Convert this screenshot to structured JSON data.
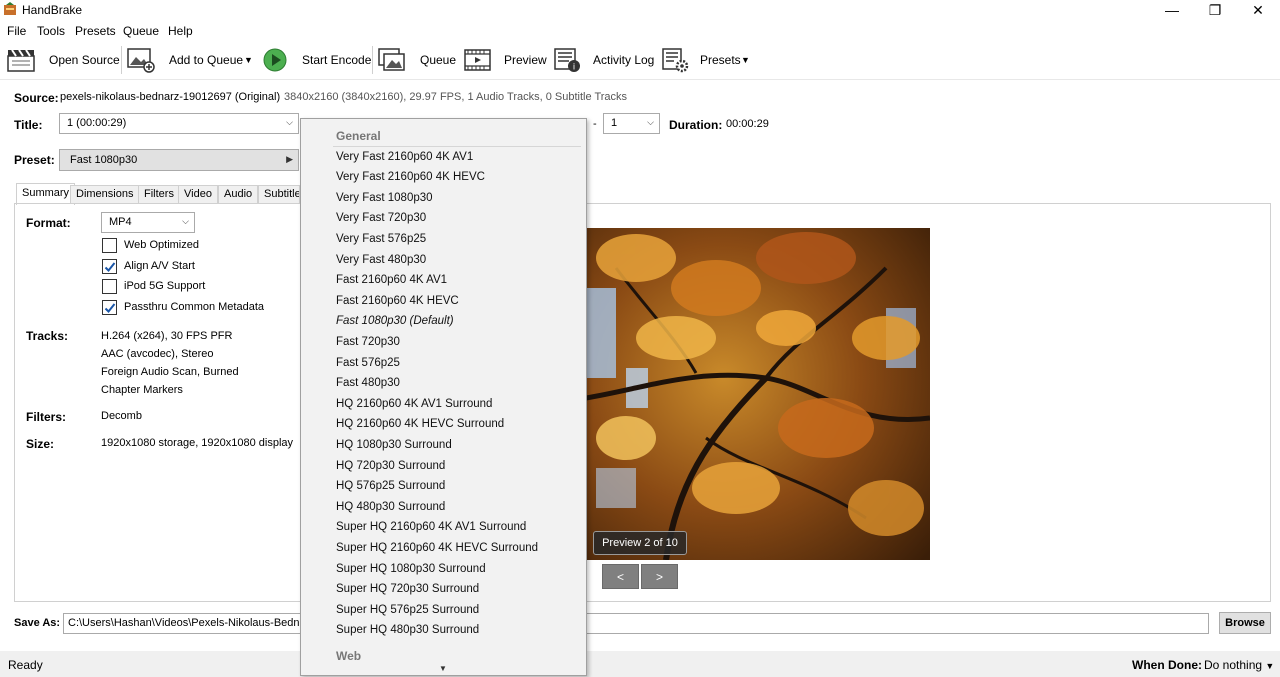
{
  "window": {
    "title": "HandBrake",
    "controls": {
      "minimize": "—",
      "restore": "❐",
      "close": "✕"
    }
  },
  "menu": [
    "File",
    "Tools",
    "Presets",
    "Queue",
    "Help"
  ],
  "toolbar": {
    "open_source": "Open Source",
    "add_to_queue": "Add to Queue",
    "start_encode": "Start Encode",
    "queue": "Queue",
    "preview": "Preview",
    "activity_log": "Activity Log",
    "presets": "Presets"
  },
  "source": {
    "label": "Source:",
    "name": "pexels-nikolaus-bednarz-19012697 (Original)",
    "info": "3840x2160 (3840x2160), 29.97 FPS, 1 Audio Tracks, 0 Subtitle Tracks"
  },
  "title_row": {
    "label": "Title:",
    "value": "1  (00:00:29)",
    "range_dash": "-",
    "range_end": "1",
    "duration_label": "Duration:",
    "duration_value": "00:00:29"
  },
  "preset_row": {
    "label": "Preset:",
    "value": "Fast 1080p30"
  },
  "tabs": [
    "Summary",
    "Dimensions",
    "Filters",
    "Video",
    "Audio",
    "Subtitle"
  ],
  "summary": {
    "format_label": "Format:",
    "format_value": "MP4",
    "checkboxes": [
      {
        "label": "Web Optimized",
        "checked": false
      },
      {
        "label": "Align A/V Start",
        "checked": true
      },
      {
        "label": "iPod 5G Support",
        "checked": false
      },
      {
        "label": "Passthru Common Metadata",
        "checked": true
      }
    ],
    "tracks_label": "Tracks:",
    "tracks": [
      "H.264 (x264), 30 FPS PFR",
      "AAC (avcodec), Stereo",
      "Foreign Audio Scan, Burned",
      "Chapter Markers"
    ],
    "filters_label": "Filters:",
    "filters_value": "Decomb",
    "size_label": "Size:",
    "size_value": "1920x1080 storage, 1920x1080 display"
  },
  "preview": {
    "badge": "Preview 2 of 10",
    "prev": "<",
    "next": ">"
  },
  "save_as": {
    "label": "Save As:",
    "value": "C:\\Users\\Hashan\\Videos\\Pexels-Nikolaus-Bednarz",
    "browse": "Browse"
  },
  "status": {
    "text": "Ready",
    "when_done_label": "When Done:",
    "when_done_value": "Do nothing"
  },
  "preset_dropdown": {
    "header": "General",
    "items": [
      "Very Fast 2160p60 4K AV1",
      "Very Fast 2160p60 4K HEVC",
      "Very Fast 1080p30",
      "Very Fast 720p30",
      "Very Fast 576p25",
      "Very Fast 480p30",
      "Fast 2160p60 4K AV1",
      "Fast 2160p60 4K HEVC",
      "Fast 1080p30 (Default)",
      "Fast 720p30",
      "Fast 576p25",
      "Fast 480p30",
      "HQ 2160p60 4K AV1 Surround",
      "HQ 2160p60 4K HEVC Surround",
      "HQ 1080p30 Surround",
      "HQ 720p30 Surround",
      "HQ 576p25 Surround",
      "HQ 480p30 Surround",
      "Super HQ 2160p60 4K AV1 Surround",
      "Super HQ 2160p60 4K HEVC Surround",
      "Super HQ 1080p30 Surround",
      "Super HQ 720p30 Surround",
      "Super HQ 576p25 Surround",
      "Super HQ 480p30 Surround"
    ],
    "footer_header": "Web",
    "selected_index": 8
  }
}
